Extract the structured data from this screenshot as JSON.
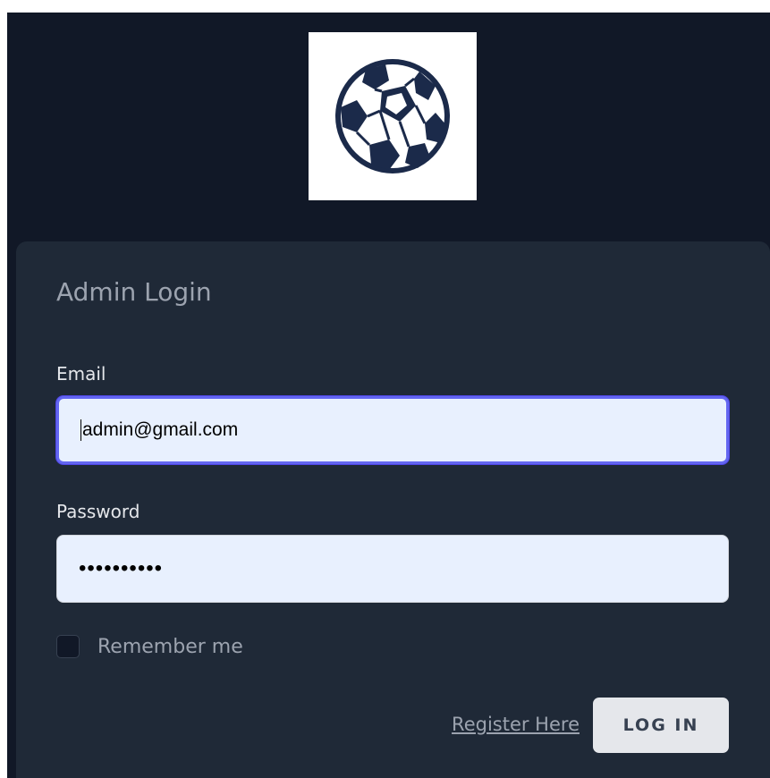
{
  "logo": {
    "icon": "soccer-ball-icon",
    "color": "#1b2a4a"
  },
  "login_card": {
    "title": "Admin Login",
    "email_label": "Email",
    "email_value": "admin@gmail.com",
    "password_label": "Password",
    "password_value": "••••••••••",
    "remember_label": "Remember me",
    "register_link": "Register Here",
    "login_button": "LOG IN"
  },
  "colors": {
    "background": "#111827",
    "card": "#1f2937",
    "focus_ring": "#6366f1",
    "input_bg": "#e8f0fe"
  }
}
